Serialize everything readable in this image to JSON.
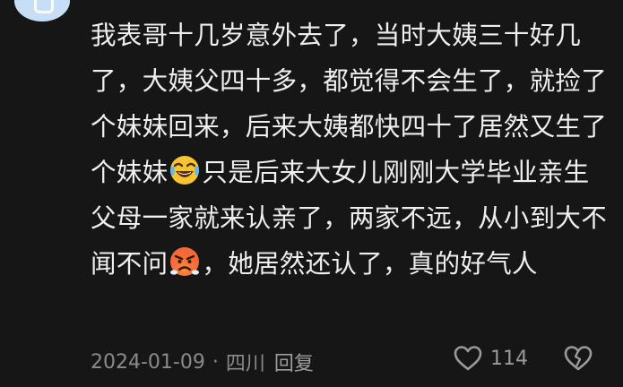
{
  "comment": {
    "segments": [
      "我表哥十几岁意外去了，当时大姨三十好几了，大姨父四十多，都觉得不会生了，就捡了个妹妹回来，后来大姨都快四十了居然又生了个妹妹",
      "只是后来大女儿刚刚大学毕业亲生父母一家就来认亲了，两家不远，从小到大不闻不问",
      "，她居然还认了，真的好气人"
    ],
    "emojis": [
      "crying-laughing-emoji",
      "angry-face-emoji"
    ]
  },
  "meta": {
    "date": "2024-01-09",
    "separator": "·",
    "location": "四川",
    "reply_label": "回复"
  },
  "actions": {
    "like_count": "114",
    "like_icon": "heart-outline-icon",
    "dislike_icon": "broken-heart-icon"
  },
  "colors": {
    "background": "#161616",
    "text": "#efefef",
    "muted": "#8a8a8a"
  }
}
